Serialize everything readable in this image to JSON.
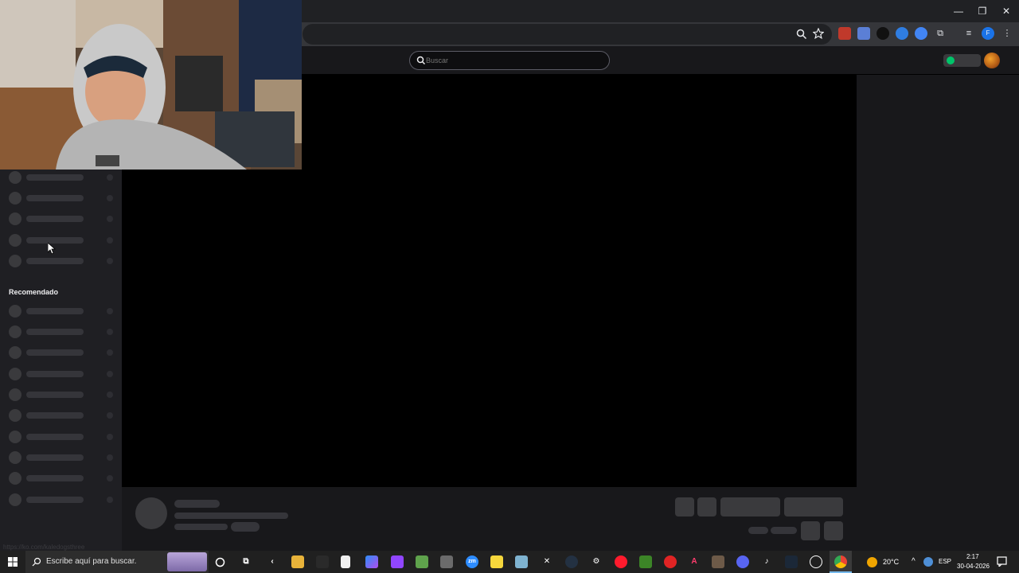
{
  "window": {
    "minimize_label": "—",
    "restore_label": "❐",
    "close_label": "✕"
  },
  "header": {
    "search_placeholder": "Buscar"
  },
  "sidebar": {
    "recommended_heading": "Recomendado"
  },
  "url_hint": "https://ko.com/kaledogsthree",
  "taskbar": {
    "search_placeholder": "Escribe aquí para buscar.",
    "temperature": "20°C",
    "language": "ESP",
    "time": "2:17",
    "date": "30-04-2026"
  },
  "colors": {
    "twitch_bg": "#0e0e10",
    "sidebar_bg": "#1f1f23",
    "skeleton": "#3a3a3d",
    "prime_green": "#00c46a"
  },
  "icons": {
    "toolbar": [
      "zoom-icon",
      "star-icon",
      "extension-icons",
      "puzzle-icon",
      "queue-icon",
      "profile-icon",
      "menu-icon"
    ],
    "taskbar": [
      "windows-start-icon",
      "search-icon",
      "cortana-icon",
      "task-view-icon",
      "file-explorer-icon",
      "twitch-icon",
      "discord-icon",
      "steam-icon",
      "chrome-icon",
      "weather-icon",
      "notifications-icon"
    ]
  }
}
